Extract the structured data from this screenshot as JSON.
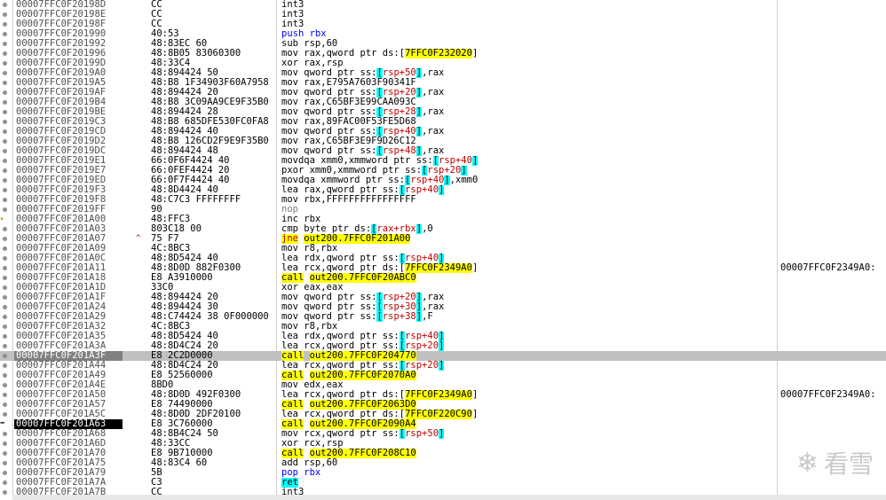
{
  "rows": [
    {
      "addr": "00007FFC0F20198D",
      "bytes": "CC",
      "mn": "int3",
      "ops": "",
      "cls": ""
    },
    {
      "addr": "00007FFC0F20198E",
      "bytes": "CC",
      "mn": "int3",
      "ops": "",
      "cls": ""
    },
    {
      "addr": "00007FFC0F20198F",
      "bytes": "CC",
      "mn": "int3",
      "ops": "",
      "cls": ""
    },
    {
      "addr": "00007FFC0F201990",
      "bytes": "40:53",
      "mn": "push rbx",
      "ops": "",
      "cls": "push"
    },
    {
      "addr": "00007FFC0F201992",
      "bytes": "48:83EC 60",
      "mn": "sub rsp,60",
      "ops": "",
      "cls": ""
    },
    {
      "addr": "00007FFC0F201996",
      "bytes": "48:8B05 83060300",
      "mn": "mov rax,qword ptr ds:[",
      "ops": "7FFC0F232020",
      "tail": "]",
      "cls": "ds"
    },
    {
      "addr": "00007FFC0F20199D",
      "bytes": "48:33C4",
      "mn": "xor rax,rsp",
      "ops": "",
      "cls": ""
    },
    {
      "addr": "00007FFC0F2019A0",
      "bytes": "48:894424 50",
      "mn": "mov qword ptr ss:[rsp+50],rax",
      "ops": "",
      "cls": "ss"
    },
    {
      "addr": "00007FFC0F2019A5",
      "bytes": "48:B8 1F34903F60A7958",
      "mn": "mov rax,E795A7603F90341F",
      "ops": "",
      "cls": "imm"
    },
    {
      "addr": "00007FFC0F2019AF",
      "bytes": "48:894424 20",
      "mn": "mov qword ptr ss:[rsp+20],rax",
      "ops": "",
      "cls": "ss"
    },
    {
      "addr": "00007FFC0F2019B4",
      "bytes": "48:B8 3C09AA9CE9F35B0",
      "mn": "mov rax,C65BF3E99CAA093C",
      "ops": "",
      "cls": "imm"
    },
    {
      "addr": "00007FFC0F2019BE",
      "bytes": "48:894424 28",
      "mn": "mov qword ptr ss:[rsp+28],rax",
      "ops": "",
      "cls": "ss"
    },
    {
      "addr": "00007FFC0F2019C3",
      "bytes": "48:B8 685DFE530FC0FA8",
      "mn": "mov rax,89FAC00F53FE5D68",
      "ops": "",
      "cls": "imm"
    },
    {
      "addr": "00007FFC0F2019CD",
      "bytes": "48:894424 40",
      "mn": "mov qword ptr ss:[rsp+40],rax",
      "ops": "",
      "cls": "ss"
    },
    {
      "addr": "00007FFC0F2019D2",
      "bytes": "48:B8 126CD2F9E9F35B0",
      "mn": "mov rax,C65BF3E9F9D26C12",
      "ops": "",
      "cls": "imm"
    },
    {
      "addr": "00007FFC0F2019DC",
      "bytes": "48:894424 48",
      "mn": "mov qword ptr ss:[rsp+48],rax",
      "ops": "",
      "cls": "ss"
    },
    {
      "addr": "00007FFC0F2019E1",
      "bytes": "66:0F6F4424 40",
      "mn": "movdqa xmm0,xmmword ptr ss:[rsp+40]",
      "ops": "",
      "cls": "ss"
    },
    {
      "addr": "00007FFC0F2019E7",
      "bytes": "66:0FEF4424 20",
      "mn": "pxor xmm0,xmmword ptr ss:[rsp+20]",
      "ops": "",
      "cls": "ss"
    },
    {
      "addr": "00007FFC0F2019ED",
      "bytes": "66:0F7F4424 40",
      "mn": "movdqa xmmword ptr ss:[rsp+40],xmm0",
      "ops": "",
      "cls": "ss"
    },
    {
      "addr": "00007FFC0F2019F3",
      "bytes": "48:8D4424 40",
      "mn": "lea rax,qword ptr ss:[rsp+40]",
      "ops": "",
      "cls": "ss"
    },
    {
      "addr": "00007FFC0F2019F8",
      "bytes": "48:C7C3 FFFFFFFF",
      "mn": "mov rbx,FFFFFFFFFFFFFFFF",
      "ops": "",
      "cls": "imm"
    },
    {
      "addr": "00007FFC0F2019FF",
      "bytes": "90",
      "mn": "nop",
      "ops": "",
      "cls": "nop"
    },
    {
      "addr": "00007FFC0F201A00",
      "bytes": "48:FFC3",
      "mn": "inc rbx",
      "ops": "",
      "cls": "",
      "arrow": true
    },
    {
      "addr": "00007FFC0F201A03",
      "bytes": "803C18 00",
      "mn": "cmp byte ptr ds:[rax+rbx],0",
      "ops": "",
      "cls": ""
    },
    {
      "addr": "00007FFC0F201A07",
      "bytes": "75 F7",
      "mn": "jne",
      "ops": "out200.7FFC0F201A00",
      "cls": "jcc",
      "jmp": "^"
    },
    {
      "addr": "00007FFC0F201A09",
      "bytes": "4C:8BC3",
      "mn": "mov r8,rbx",
      "ops": "",
      "cls": ""
    },
    {
      "addr": "00007FFC0F201A0C",
      "bytes": "48:8D5424 40",
      "mn": "lea rdx,qword ptr ss:[rsp+40]",
      "ops": "",
      "cls": "ss"
    },
    {
      "addr": "00007FFC0F201A11",
      "bytes": "48:8D0D 882F0300",
      "mn": "lea rcx,qword ptr ds:[",
      "ops": "7FFC0F2349A0",
      "tail": "]",
      "cls": "ds",
      "comment": "00007FFC0F2349A0:"
    },
    {
      "addr": "00007FFC0F201A18",
      "bytes": "E8 A3910000",
      "mn": "call",
      "ops": "out200.7FFC0F20ABC0",
      "cls": "call"
    },
    {
      "addr": "00007FFC0F201A1D",
      "bytes": "33C0",
      "mn": "xor eax,eax",
      "ops": "",
      "cls": ""
    },
    {
      "addr": "00007FFC0F201A1F",
      "bytes": "48:894424 20",
      "mn": "mov qword ptr ss:[rsp+20],rax",
      "ops": "",
      "cls": "ss"
    },
    {
      "addr": "00007FFC0F201A24",
      "bytes": "48:894424 30",
      "mn": "mov qword ptr ss:[rsp+30],rax",
      "ops": "",
      "cls": "ss"
    },
    {
      "addr": "00007FFC0F201A29",
      "bytes": "48:C74424 38 0F000000",
      "mn": "mov qword ptr ss:[rsp+38],F",
      "ops": "",
      "cls": "ss"
    },
    {
      "addr": "00007FFC0F201A32",
      "bytes": "4C:8BC3",
      "mn": "mov r8,rbx",
      "ops": "",
      "cls": ""
    },
    {
      "addr": "00007FFC0F201A35",
      "bytes": "48:8D5424 40",
      "mn": "lea rdx,qword ptr ss:[rsp+40]",
      "ops": "",
      "cls": "ss"
    },
    {
      "addr": "00007FFC0F201A3A",
      "bytes": "48:8D4C24 20",
      "mn": "lea rcx,qword ptr ss:[rsp+20]",
      "ops": "",
      "cls": "ss"
    },
    {
      "addr": "00007FFC0F201A3F",
      "bytes": "E8 2C2D0000",
      "mn": "call",
      "ops": "out200.7FFC0F204770",
      "cls": "call",
      "sel": true
    },
    {
      "addr": "00007FFC0F201A44",
      "bytes": "48:8D4C24 20",
      "mn": "lea rcx,qword ptr ss:[rsp+20]",
      "ops": "",
      "cls": "ss"
    },
    {
      "addr": "00007FFC0F201A49",
      "bytes": "E8 52560000",
      "mn": "call",
      "ops": "out200.7FFC0F2070A0",
      "cls": "call"
    },
    {
      "addr": "00007FFC0F201A4E",
      "bytes": "8BD0",
      "mn": "mov edx,eax",
      "ops": "",
      "cls": ""
    },
    {
      "addr": "00007FFC0F201A50",
      "bytes": "48:8D0D 492F0300",
      "mn": "lea rcx,qword ptr ds:[",
      "ops": "7FFC0F2349A0",
      "tail": "]",
      "cls": "ds",
      "comment": "00007FFC0F2349A0:"
    },
    {
      "addr": "00007FFC0F201A57",
      "bytes": "E8 74490000",
      "mn": "call",
      "ops": "out200.7FFC0F2063D0",
      "cls": "call"
    },
    {
      "addr": "00007FFC0F201A5C",
      "bytes": "48:8D0D 2DF20100",
      "mn": "lea rcx,qword ptr ds:[",
      "ops": "7FFC0F220C90",
      "tail": "]",
      "cls": "ds"
    },
    {
      "addr": "00007FFC0F201A63",
      "bytes": "E8 3C760000",
      "mn": "call",
      "ops": "out200.7FFC0F2090A4",
      "cls": "call",
      "cur": true
    },
    {
      "addr": "00007FFC0F201A68",
      "bytes": "48:8B4C24 50",
      "mn": "mov rcx,qword ptr ss:[rsp+50]",
      "ops": "",
      "cls": "ss"
    },
    {
      "addr": "00007FFC0F201A6D",
      "bytes": "48:33CC",
      "mn": "xor rcx,rsp",
      "ops": "",
      "cls": ""
    },
    {
      "addr": "00007FFC0F201A70",
      "bytes": "E8 9B710000",
      "mn": "call",
      "ops": "out200.7FFC0F208C10",
      "cls": "call"
    },
    {
      "addr": "00007FFC0F201A75",
      "bytes": "48:83C4 60",
      "mn": "add rsp,60",
      "ops": "",
      "cls": ""
    },
    {
      "addr": "00007FFC0F201A79",
      "bytes": "5B",
      "mn": "pop rbx",
      "ops": "",
      "cls": "push"
    },
    {
      "addr": "00007FFC0F201A7A",
      "bytes": "C3",
      "mn": "ret",
      "ops": "",
      "cls": "ret"
    },
    {
      "addr": "00007FFC0F201A7B",
      "bytes": "CC",
      "mn": "int3",
      "ops": "",
      "cls": ""
    }
  ],
  "watermark": {
    "text": "看雪",
    "icon": "snowflake-icon"
  }
}
